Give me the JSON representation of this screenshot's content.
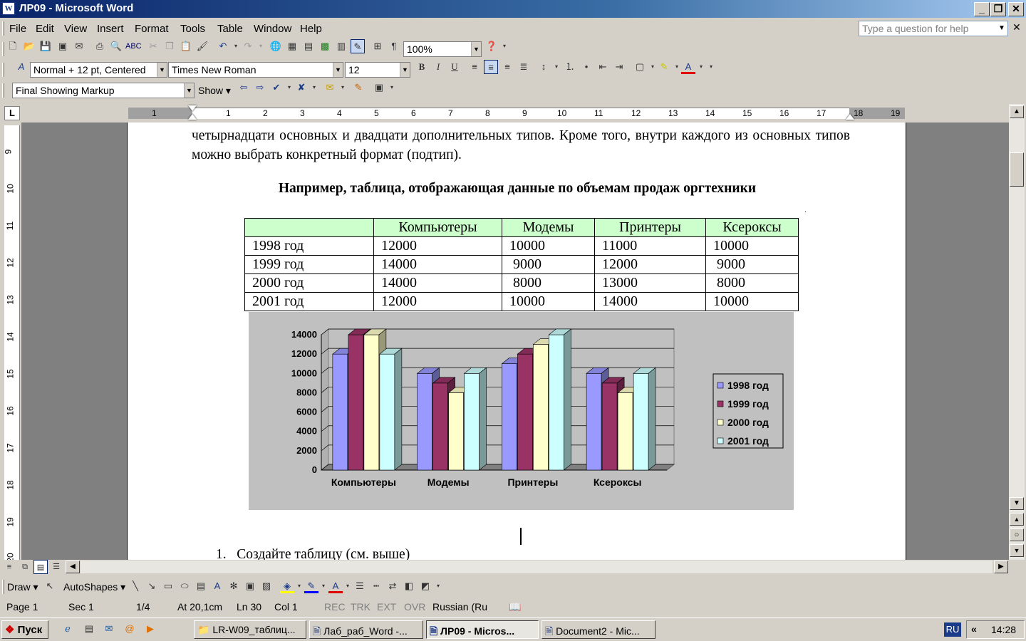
{
  "window": {
    "title": "ЛР09 - Microsoft Word",
    "minimize": "_",
    "restore": "❐",
    "close": "✕"
  },
  "menu": {
    "items": [
      "File",
      "Edit",
      "View",
      "Insert",
      "Format",
      "Tools",
      "Table",
      "Window",
      "Help"
    ],
    "help_placeholder": "Type a question for help"
  },
  "standard_toolbar": {
    "zoom": "100%"
  },
  "format_toolbar": {
    "style": "Normal + 12 pt, Centered",
    "font": "Times New Roman",
    "size": "12",
    "bold": "B",
    "italic": "I",
    "underline": "U"
  },
  "review_toolbar": {
    "display": "Final Showing Markup",
    "show": "Show"
  },
  "ruler": {
    "tab_selector": "L",
    "h_numbers": [
      "1",
      "1",
      "2",
      "3",
      "4",
      "5",
      "6",
      "7",
      "8",
      "9",
      "10",
      "11",
      "12",
      "13",
      "14",
      "15",
      "16",
      "17",
      "18",
      "19"
    ],
    "v_numbers": [
      "9",
      "10",
      "11",
      "12",
      "13",
      "14",
      "15",
      "16",
      "17",
      "18",
      "19",
      "20"
    ]
  },
  "document": {
    "paragraph": "четырнадцати основных и двадцати дополнительных типов. Кроме того, внутри каждого из основных типов можно выбрать конкретный формат (подтип).",
    "table_title": "Например, таблица, отображающая данные по объемам продаж оргтехники",
    "table": {
      "headers": [
        "",
        "Компьютеры",
        "Модемы",
        "Принтеры",
        "Ксероксы"
      ],
      "rows": [
        [
          "1998 год",
          "12000",
          "10000",
          "11000",
          "10000"
        ],
        [
          "1999 год",
          "14000",
          " 9000",
          "12000",
          " 9000"
        ],
        [
          "2000 год",
          "14000",
          " 8000",
          "13000",
          " 8000"
        ],
        [
          "2001 год",
          "12000",
          "10000",
          "14000",
          "10000"
        ]
      ]
    },
    "list_item": "1.   Создайте таблицу (см. выше)"
  },
  "chart_data": {
    "type": "bar",
    "categories": [
      "Компьютеры",
      "Модемы",
      "Принтеры",
      "Ксероксы"
    ],
    "series": [
      {
        "name": "1998 год",
        "values": [
          12000,
          10000,
          11000,
          10000
        ],
        "color": "#9999ff"
      },
      {
        "name": "1999 год",
        "values": [
          14000,
          9000,
          12000,
          9000
        ],
        "color": "#993366"
      },
      {
        "name": "2000 год",
        "values": [
          14000,
          8000,
          13000,
          8000
        ],
        "color": "#ffffcc"
      },
      {
        "name": "2001 год",
        "values": [
          12000,
          10000,
          14000,
          10000
        ],
        "color": "#ccffff"
      }
    ],
    "yticks": [
      "0",
      "2000",
      "4000",
      "6000",
      "8000",
      "10000",
      "12000",
      "14000"
    ],
    "ylim": [
      0,
      14000
    ],
    "grid": true,
    "legend": "right",
    "style": "3d-clustered-column"
  },
  "drawing_toolbar": {
    "draw": "Draw",
    "autoshapes": "AutoShapes"
  },
  "status": {
    "page": "Page 1",
    "sec": "Sec 1",
    "pages": "1/4",
    "at": "At 20,1cm",
    "ln": "Ln 30",
    "col": "Col 1",
    "rec": "REC",
    "trk": "TRK",
    "ext": "EXT",
    "ovr": "OVR",
    "lang": "Russian (Ru"
  },
  "taskbar": {
    "start": "Пуск",
    "tasks": [
      "LR-W09_таблиц...",
      "Лаб_раб_Word -...",
      "ЛР09 - Micros...",
      "Document2 - Mic..."
    ],
    "lang": "RU",
    "chevron": "«",
    "time": "14:28"
  }
}
